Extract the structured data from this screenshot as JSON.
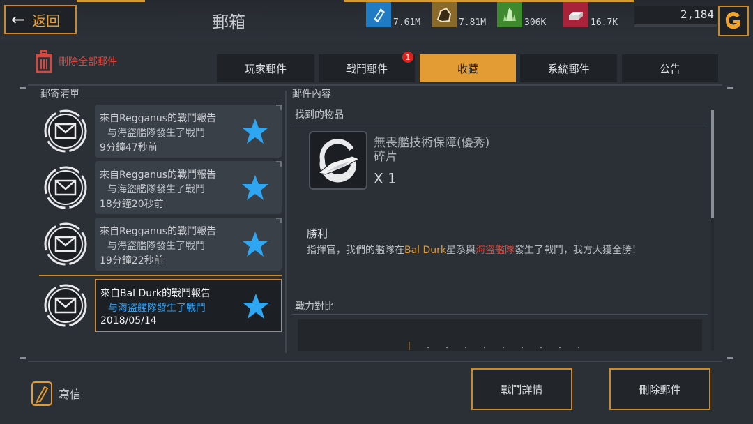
{
  "header": {
    "back_label": "返回",
    "title": "郵箱",
    "resources": [
      {
        "icon": "crystal-shard-icon",
        "value": "7.61M",
        "color": "#1f7bc4"
      },
      {
        "icon": "ore-rock-icon",
        "value": "7.81M",
        "color": "#8a6a2a"
      },
      {
        "icon": "green-crystal-icon",
        "value": "306K",
        "color": "#3f8a2e"
      },
      {
        "icon": "metal-ingot-icon",
        "value": "16.7K",
        "color": "#a8233a"
      }
    ],
    "credits": "2,184"
  },
  "toolbar": {
    "delete_all_label": "刪除全部郵件"
  },
  "tabs": [
    {
      "label": "玩家郵件",
      "active": false
    },
    {
      "label": "戰鬥郵件",
      "active": false,
      "badge": "1"
    },
    {
      "label": "收藏",
      "active": true
    },
    {
      "label": "系統郵件",
      "active": false
    },
    {
      "label": "公告",
      "active": false
    }
  ],
  "mail_list": {
    "label": "郵寄清單",
    "items": [
      {
        "title": "來自Regganus的戰鬥報告",
        "subtitle": "与海盜艦隊發生了戰鬥",
        "time": "9分鐘47秒前",
        "selected": false
      },
      {
        "title": "來自Regganus的戰鬥報告",
        "subtitle": "与海盜艦隊發生了戰鬥",
        "time": "18分鐘20秒前",
        "selected": false
      },
      {
        "title": "來自Regganus的戰鬥報告",
        "subtitle": "与海盜艦隊發生了戰鬥",
        "time": "19分鐘22秒前",
        "selected": false
      },
      {
        "title": "來自Bal Durk的戰鬥報告",
        "subtitle": "与海盜艦隊發生了戰鬥",
        "time": "2018/05/14",
        "selected": true
      }
    ]
  },
  "content": {
    "label": "郵件內容",
    "found_label": "找到的物品",
    "item_name": "無畏艦技術保障(優秀) 碎片",
    "item_qty": "X 1",
    "result": "勝利",
    "message_parts": {
      "p1": "指揮官，我們的艦隊在",
      "p2": "Bal Durk",
      "p3": "星系與",
      "p4": "海盜艦隊",
      "p5": "發生了戰鬥，我方大獲全勝！"
    },
    "power_label": "戰力對比"
  },
  "footer": {
    "write_label": "寫信",
    "battle_details_label": "戰鬥詳情",
    "delete_mail_label": "刪除郵件"
  }
}
